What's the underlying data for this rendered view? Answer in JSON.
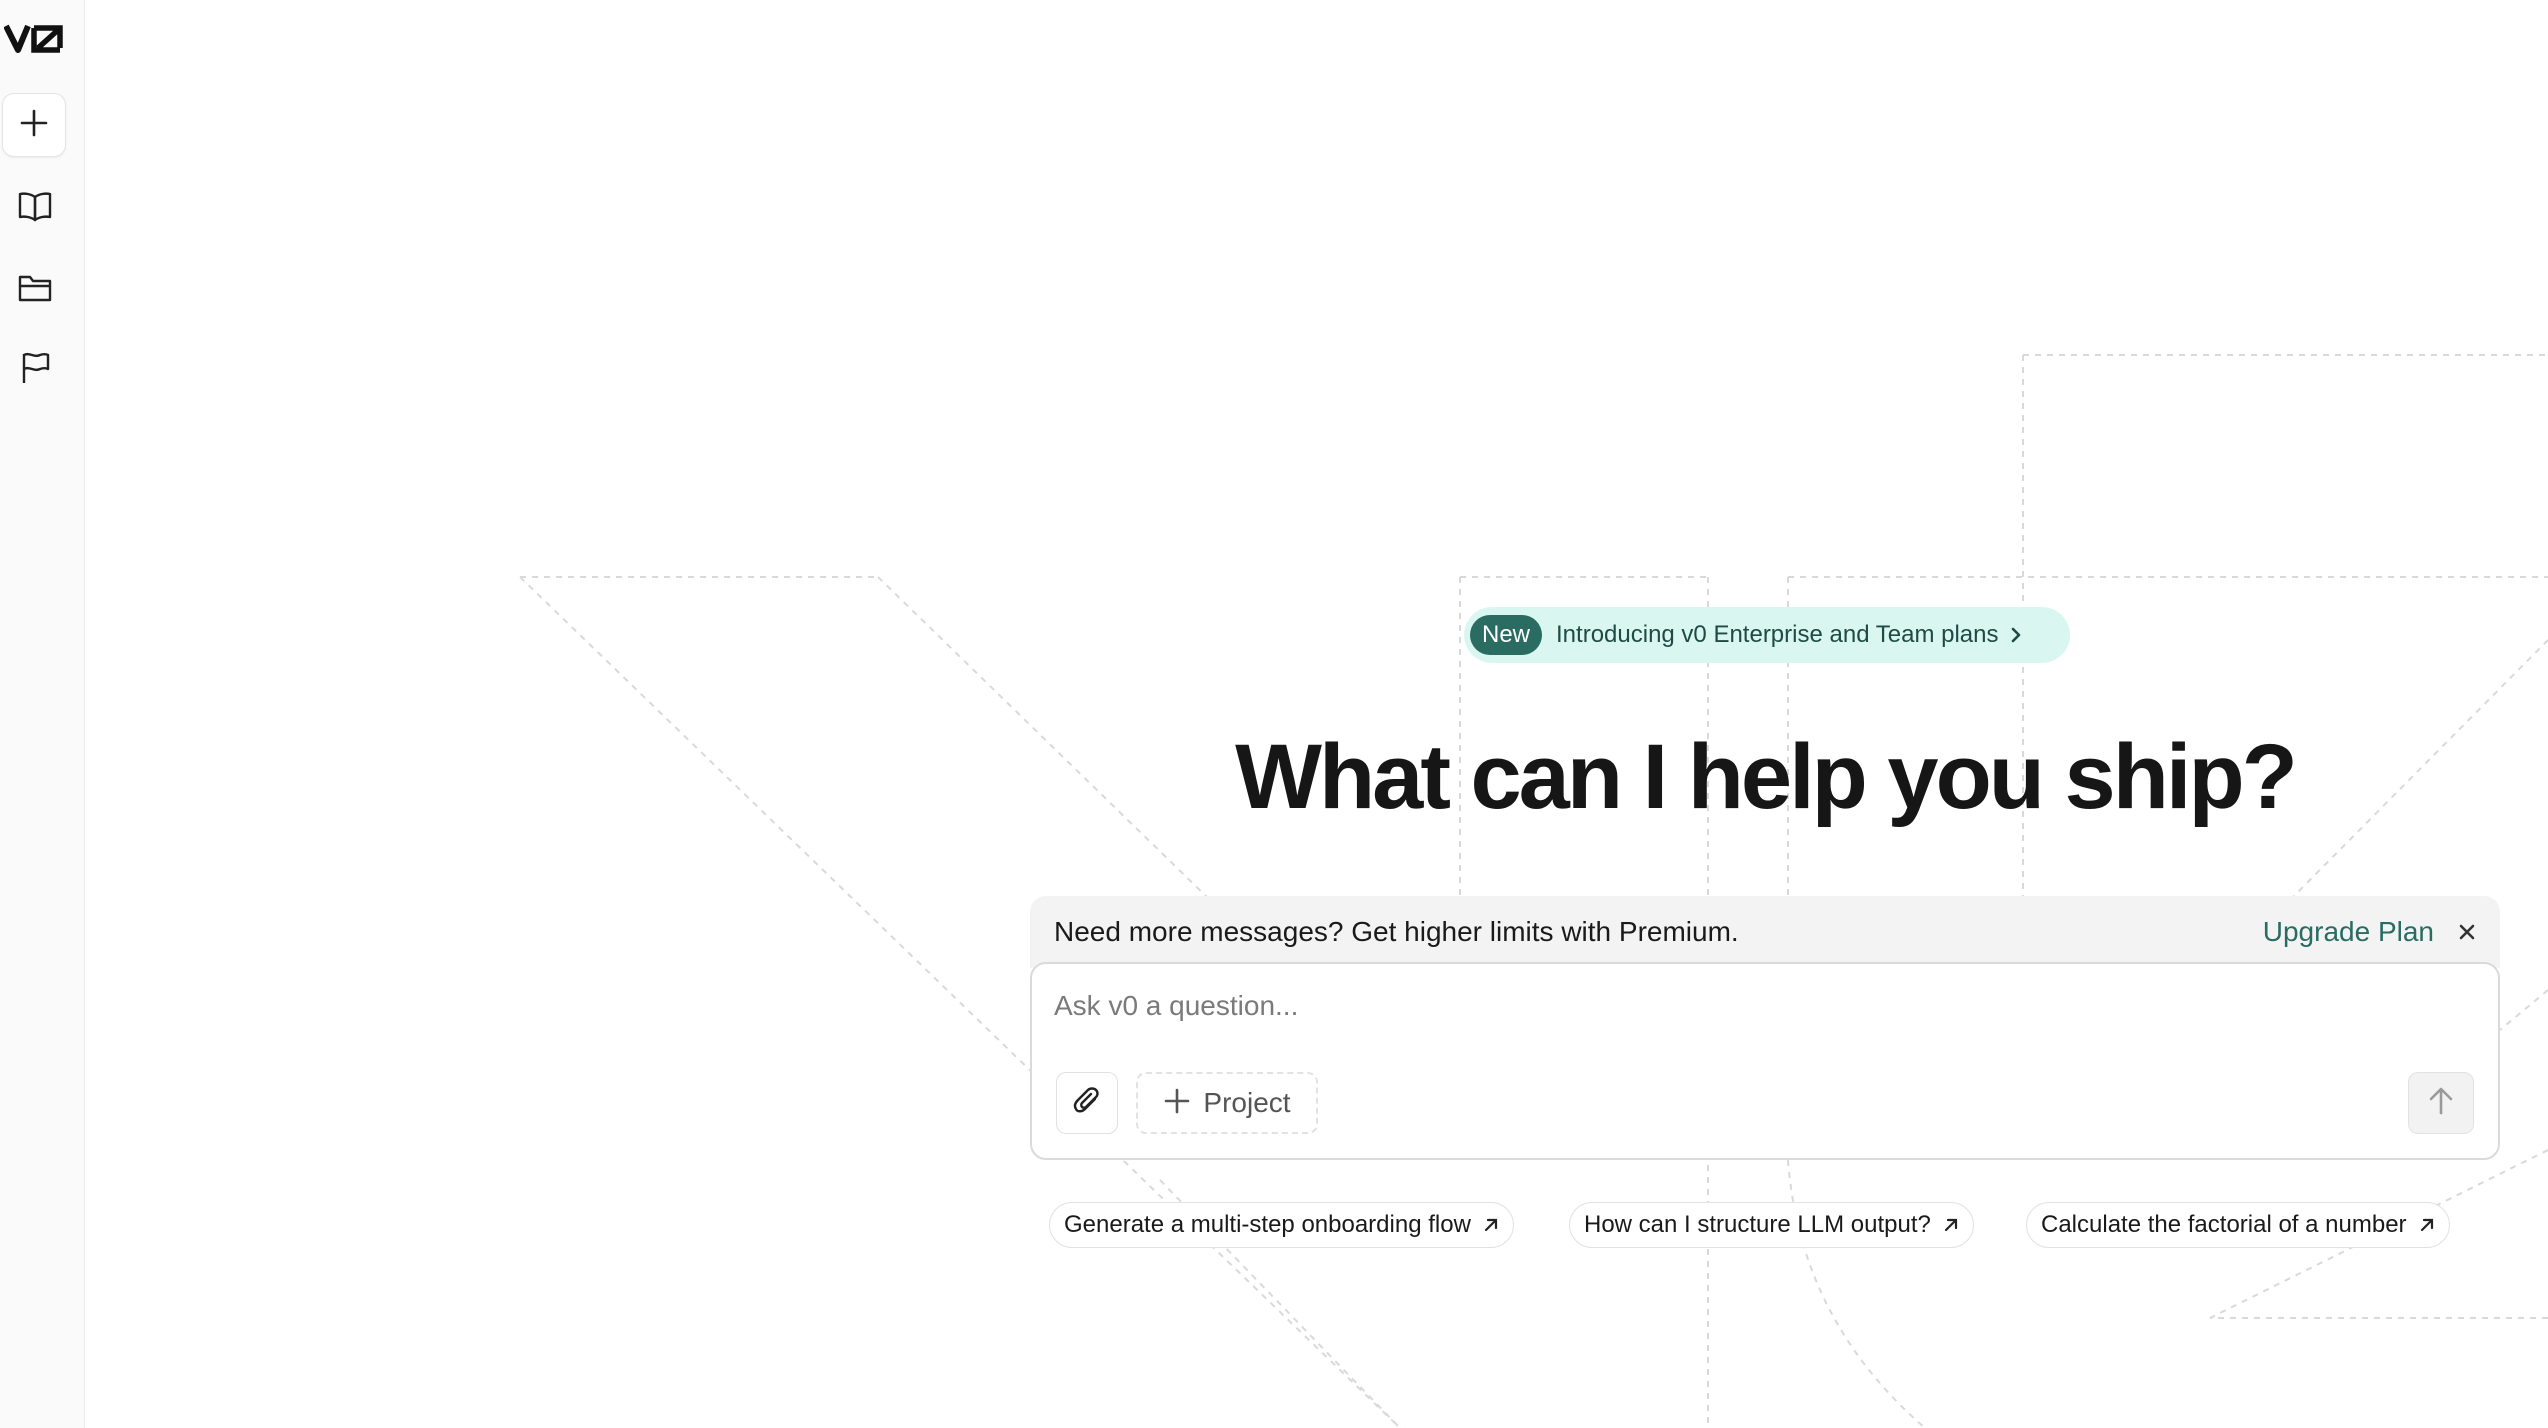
{
  "sidebar": {
    "logo_name": "v0-logo",
    "items": [
      {
        "name": "new-chat",
        "icon": "plus-icon"
      },
      {
        "name": "library",
        "icon": "book-icon"
      },
      {
        "name": "projects",
        "icon": "folder-icon"
      },
      {
        "name": "feedback",
        "icon": "flag-icon"
      }
    ]
  },
  "announcement": {
    "badge": "New",
    "text": "Introducing v0 Enterprise and Team plans",
    "icon": "chevron-right-icon",
    "colors": {
      "background": "#d9f7f0",
      "badge": "#2a6b62"
    }
  },
  "headline": "What can I help you ship?",
  "banner": {
    "text": "Need more messages? Get higher limits with Premium.",
    "upgrade_label": "Upgrade Plan",
    "close_icon": "close-icon",
    "accent": "#2a6b62"
  },
  "prompt": {
    "placeholder": "Ask v0 a question...",
    "value": "",
    "attach_icon": "paperclip-icon",
    "project_label": "Project",
    "send_icon": "arrow-up-icon"
  },
  "suggestions": [
    {
      "label": "Generate a multi-step onboarding flow",
      "icon": "arrow-up-right-icon"
    },
    {
      "label": "How can I structure LLM output?",
      "icon": "arrow-up-right-icon"
    },
    {
      "label": "Calculate the factorial of a number",
      "icon": "arrow-up-right-icon"
    }
  ]
}
